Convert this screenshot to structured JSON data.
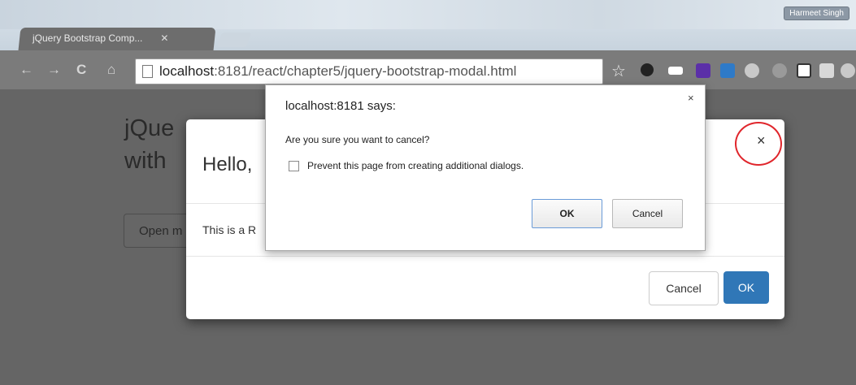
{
  "browser": {
    "tab_title": "jQuery Bootstrap Comp...",
    "tab_close": "✕",
    "url_host": "localhost",
    "url_rest": ":8181/react/chapter5/jquery-bootstrap-modal.html",
    "user_badge": "Harmeet Singh",
    "nav_back": "←",
    "nav_forward": "→",
    "nav_reload": "C",
    "nav_home": "⌂",
    "star": "☆"
  },
  "page": {
    "heading_line1": "jQue",
    "heading_line2": "with",
    "open_button": "Open m"
  },
  "modal": {
    "title": "Hello,",
    "close": "×",
    "body": "This is a R",
    "cancel_label": "Cancel",
    "ok_label": "OK"
  },
  "confirm": {
    "title": "localhost:8181 says:",
    "close": "×",
    "message": "Are you sure you want to cancel?",
    "checkbox_label": "Prevent this page from creating additional dialogs.",
    "ok_label": "OK",
    "cancel_label": "Cancel"
  },
  "colors": {
    "primary": "#3077b7",
    "highlight_circle": "#e0262c"
  }
}
